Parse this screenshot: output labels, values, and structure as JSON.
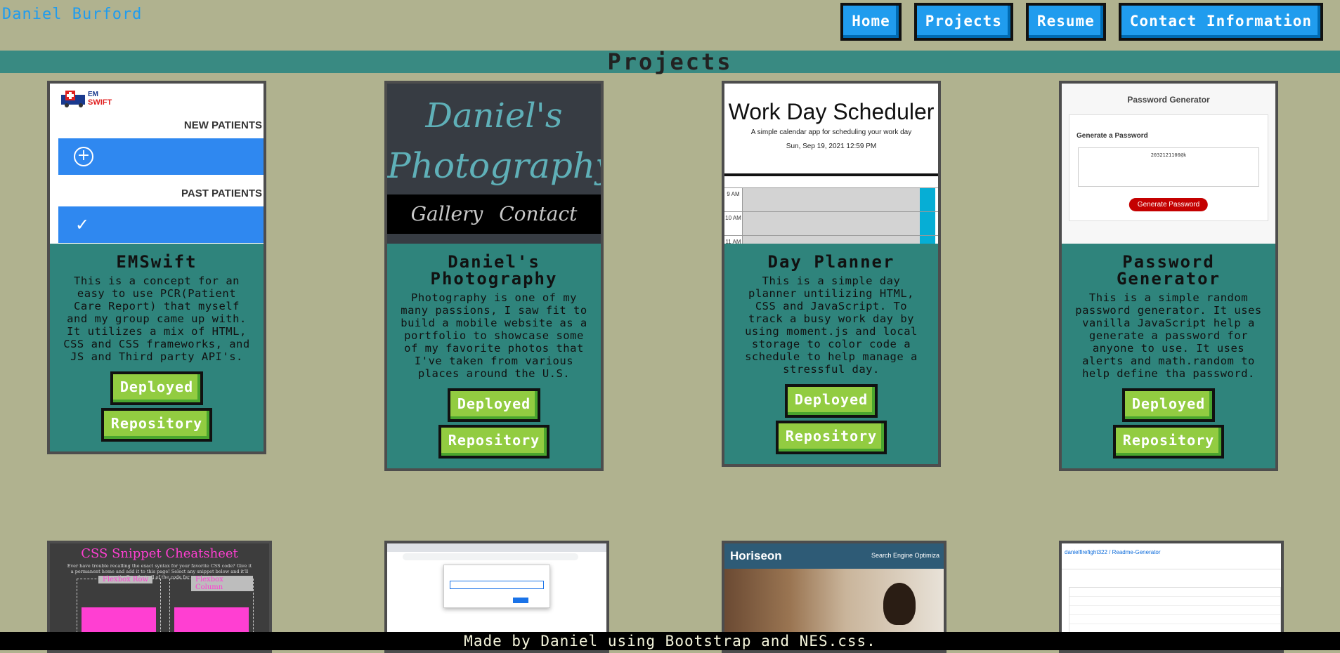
{
  "header": {
    "brand": "Daniel Burford",
    "nav": [
      "Home",
      "Projects",
      "Resume",
      "Contact Information"
    ]
  },
  "section": {
    "title": "Projects"
  },
  "projects": [
    {
      "title": "EMSwift",
      "description": "This is a concept for an easy to use PCR(Patient Care Report) that myself and my group came up with. It utilizes a mix of HTML, CSS and CSS frameworks, and JS and Third party API's.",
      "thumb": {
        "new_patients": "NEW PATIENTS",
        "past_patients": "PAST PATIENTS",
        "add_icon": "plus-circle-icon",
        "check_icon": "check-icon"
      }
    },
    {
      "title": "Daniel's Photography",
      "description": "Photography is one of my many passions, I saw fit to build a mobile website as a portfolio to showcase some of my favorite photos that I've taken from various places around the U.S.",
      "thumb": {
        "line1": "Daniel's",
        "line2": "Photography",
        "menu": "Gallery  Contact"
      }
    },
    {
      "title": "Day Planner",
      "description": "This is a simple day planner untilizing HTML, CSS and JavaScript. To track a busy work day by using moment.js and local storage to color code a schedule to help manage a stressful day.",
      "thumb": {
        "heading": "Work Day Scheduler",
        "subheading": "A simple calendar app for scheduling your work day",
        "date": "Sun, Sep 19, 2021 12:59 PM",
        "hours": [
          "9 AM",
          "10 AM",
          "11 AM"
        ]
      }
    },
    {
      "title": "Password Generator",
      "description": "This is a simple random password generator. It uses vanilla JavaScript help a generate a password for anyone to use. It uses alerts and math.random to help define tha password.",
      "thumb": {
        "heading": "Password Generator",
        "label": "Generate a Password",
        "output": "2032121100@k",
        "button": "Generate Password"
      }
    }
  ],
  "buttons": {
    "deployed": "Deployed",
    "repository": "Repository"
  },
  "bottom_thumbs": {
    "css_title": "CSS Snippet Cheatsheet",
    "css_intro": "Ever have trouble recalling the exact syntax for your favorite CSS code? Give it a permanent home and add it to this page! Select any snippet below and it'll automatically select all of the code for you to copy.",
    "css_row": "Flexbox Row",
    "css_col": "Flexbox Column",
    "horiseon_brand": "Horiseon",
    "horiseon_tag": "Search Engine Optimiza",
    "github_repo": "danielfirefight322 / Readme-Generator"
  },
  "footer": {
    "text": "Made by Daniel using Bootstrap and NES.css."
  }
}
